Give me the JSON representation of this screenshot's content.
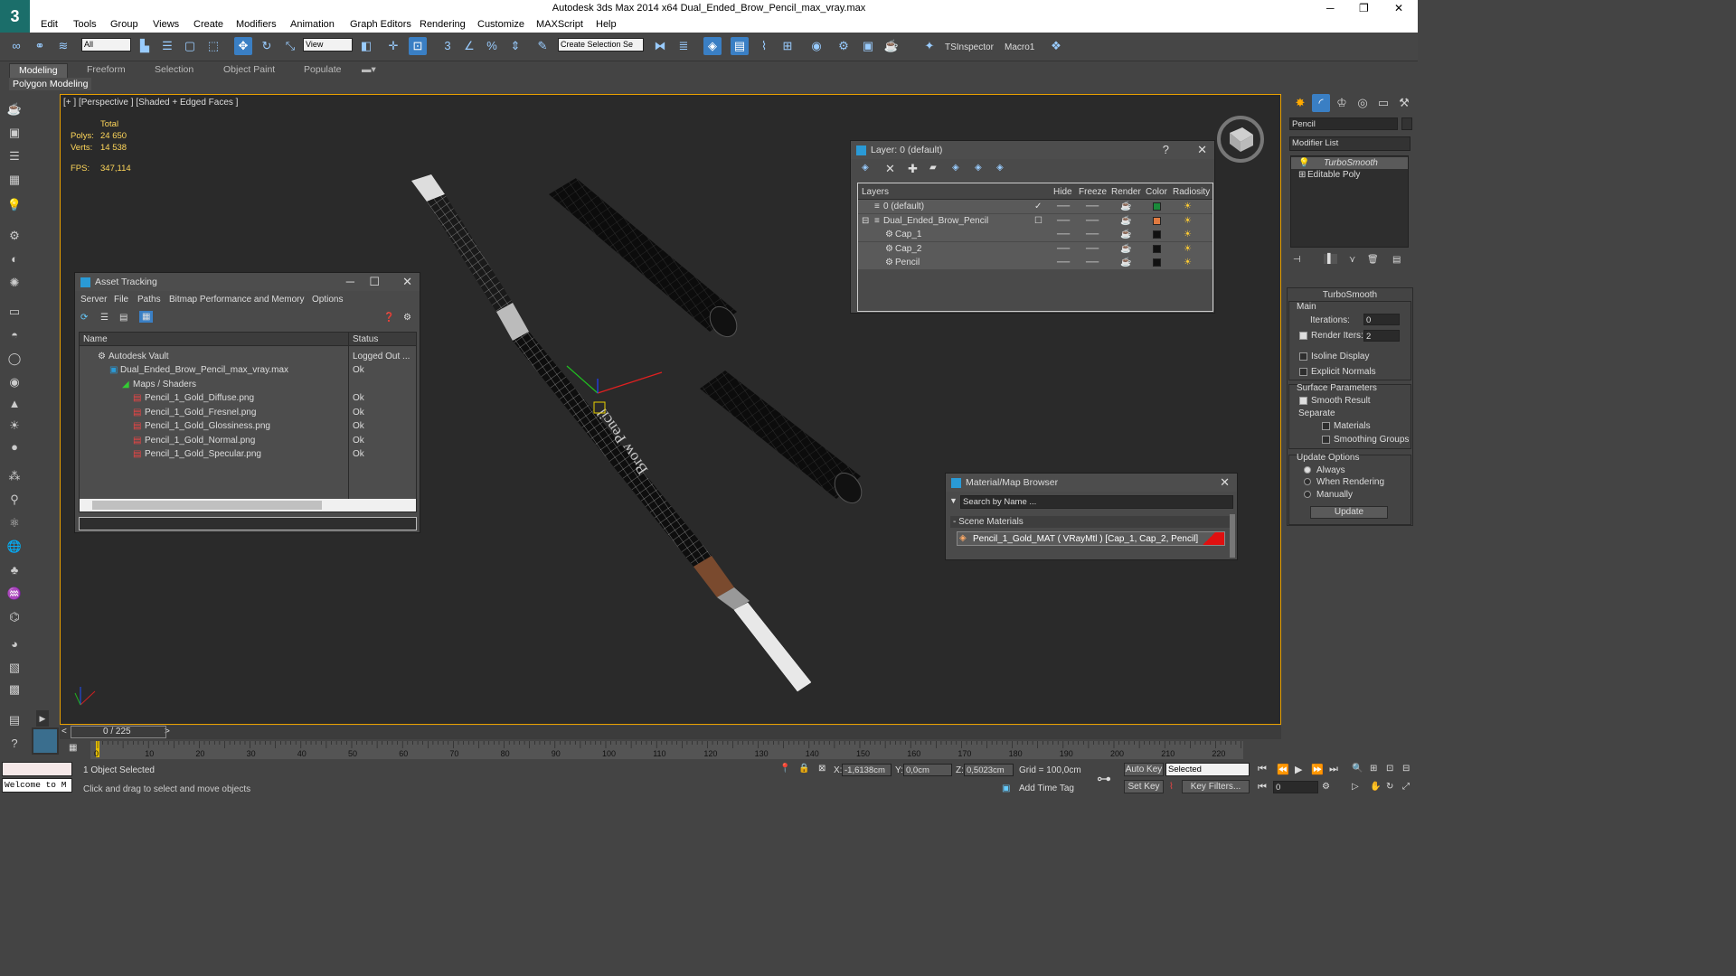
{
  "window": {
    "title": "Autodesk 3ds Max  2014 x64     Dual_Ended_Brow_Pencil_max_vray.max"
  },
  "menu": [
    "Edit",
    "Tools",
    "Group",
    "Views",
    "Create",
    "Modifiers",
    "Animation",
    "Graph Editors",
    "Rendering",
    "Customize",
    "MAXScript",
    "Help"
  ],
  "toolbar": {
    "filter": "All",
    "refcoord": "View",
    "selset": "Create Selection Se",
    "tsinspector": "TSInspector",
    "macro": "Macro1"
  },
  "ribbon": {
    "tabs": [
      "Modeling",
      "Freeform",
      "Selection",
      "Object Paint",
      "Populate"
    ],
    "panel": "Polygon Modeling"
  },
  "viewport": {
    "label": "[+ ] [Perspective ] [Shaded + Edged Faces ]",
    "stats_header": "Total",
    "polys_label": "Polys:",
    "polys": "24 650",
    "verts_label": "Verts:",
    "verts": "14 538",
    "fps_label": "FPS:",
    "fps": "347,114",
    "text_on_pencil": "Brow Pencil"
  },
  "asset_tracking": {
    "title": "Asset Tracking",
    "menu": [
      "Server",
      "File",
      "Paths",
      "Bitmap Performance and Memory",
      "Options"
    ],
    "col_name": "Name",
    "col_status": "Status",
    "rows": [
      {
        "name": "Autodesk Vault",
        "status": "Logged Out ..."
      },
      {
        "name": "Dual_Ended_Brow_Pencil_max_vray.max",
        "status": "Ok"
      },
      {
        "name": "Maps / Shaders",
        "status": ""
      },
      {
        "name": "Pencil_1_Gold_Diffuse.png",
        "status": "Ok"
      },
      {
        "name": "Pencil_1_Gold_Fresnel.png",
        "status": "Ok"
      },
      {
        "name": "Pencil_1_Gold_Glossiness.png",
        "status": "Ok"
      },
      {
        "name": "Pencil_1_Gold_Normal.png",
        "status": "Ok"
      },
      {
        "name": "Pencil_1_Gold_Specular.png",
        "status": "Ok"
      }
    ]
  },
  "layer": {
    "title": "Layer: 0 (default)",
    "help": "?",
    "cols": [
      "Layers",
      "Hide",
      "Freeze",
      "Render",
      "Color",
      "Radiosity"
    ],
    "rows": [
      {
        "name": "0 (default)",
        "color": "#1a8a3a"
      },
      {
        "name": "Dual_Ended_Brow_Pencil",
        "color": "#e07a40"
      },
      {
        "name": "Cap_1",
        "color": "#111111"
      },
      {
        "name": "Cap_2",
        "color": "#111111"
      },
      {
        "name": "Pencil",
        "color": "#111111"
      }
    ]
  },
  "material_browser": {
    "title": "Material/Map Browser",
    "search_placeholder": "Search by Name ...",
    "group": "- Scene Materials",
    "item": "Pencil_1_Gold_MAT  ( VRayMtl )  [Cap_1, Cap_2, Pencil]"
  },
  "command_panel": {
    "object_name": "Pencil",
    "modifier_list": "Modifier List",
    "stack": [
      "TurboSmooth",
      "Editable Poly"
    ],
    "rollout": "TurboSmooth",
    "main": "Main",
    "iterations_label": "Iterations:",
    "iterations": "0",
    "render_iters_label": "Render Iters:",
    "render_iters": "2",
    "isoline": "Isoline Display",
    "explicit": "Explicit Normals",
    "surface": "Surface Parameters",
    "smooth_result": "Smooth Result",
    "separate": "Separate",
    "materials": "Materials",
    "smoothing_groups": "Smoothing Groups",
    "update_options": "Update Options",
    "always": "Always",
    "when_rendering": "When Rendering",
    "manually": "Manually",
    "update": "Update"
  },
  "timeline": {
    "frame": "0 / 225",
    "ticks": [
      "0",
      "10",
      "20",
      "30",
      "40",
      "50",
      "60",
      "70",
      "80",
      "90",
      "100",
      "110",
      "120",
      "130",
      "140",
      "150",
      "160",
      "170",
      "180",
      "190",
      "200",
      "210",
      "220"
    ]
  },
  "status": {
    "welcome": "Welcome to M",
    "selected": "1 Object Selected",
    "hint": "Click and drag to select and move objects",
    "x_label": "X:",
    "x": "-1,6138cm",
    "y_label": "Y:",
    "y": "0,0cm",
    "z_label": "Z:",
    "z": "0,5023cm",
    "grid": "Grid = 100,0cm",
    "add_time_tag": "Add Time Tag",
    "auto_key": "Auto Key",
    "set_key": "Set Key",
    "selected_dd": "Selected",
    "key_filters": "Key Filters...",
    "frame": "0"
  }
}
